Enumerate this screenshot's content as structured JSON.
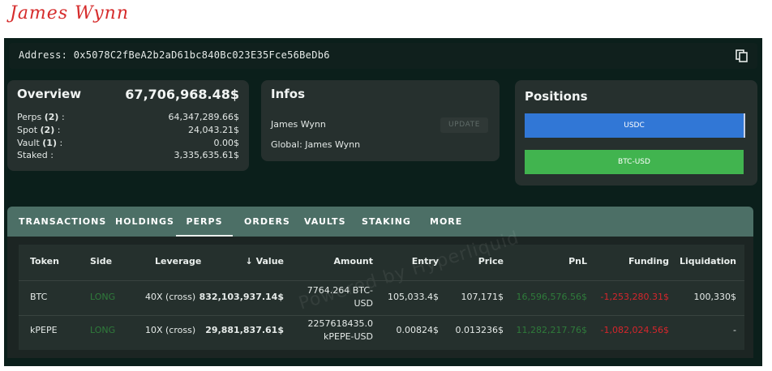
{
  "page_title": "James Wynn",
  "address": {
    "label": "Address:",
    "value": "0x5078C2fBeA2b2aD61bc840Bc023E35Fce56BeDb6"
  },
  "overview": {
    "heading": "Overview",
    "total": "67,706,968.48$",
    "rows": [
      {
        "label": "Perps",
        "count": "(2)",
        "suffix": " :",
        "value": "64,347,289.66$"
      },
      {
        "label": "Spot",
        "count": "(2)",
        "suffix": " :",
        "value": "24,043.21$"
      },
      {
        "label": "Vault",
        "count": "(1)",
        "suffix": " :",
        "value": "0.00$"
      },
      {
        "label": "Staked",
        "count": "",
        "suffix": " :",
        "value": "3,335,635.61$"
      }
    ]
  },
  "infos": {
    "heading": "Infos",
    "name": "James Wynn",
    "global": "Global: James Wynn",
    "update_label": "UPDATE"
  },
  "positions": {
    "heading": "Positions",
    "bars": [
      {
        "label": "USDC",
        "color": "#3177d6"
      },
      {
        "label": "BTC-USD",
        "color": "#41b44f"
      }
    ]
  },
  "tabs": [
    {
      "label": "TRANSACTIONS",
      "active": false
    },
    {
      "label": "HOLDINGS",
      "active": false
    },
    {
      "label": "PERPS",
      "active": true
    },
    {
      "label": "ORDERS",
      "active": false
    },
    {
      "label": "VAULTS",
      "active": false
    },
    {
      "label": "STAKING",
      "active": false
    },
    {
      "label": "MORE",
      "active": false
    }
  ],
  "table": {
    "headers": {
      "token": "Token",
      "side": "Side",
      "leverage": "Leverage",
      "value": "↓ Value",
      "amount": "Amount",
      "entry": "Entry",
      "price": "Price",
      "pnl": "PnL",
      "funding": "Funding",
      "liquidation": "Liquidation"
    },
    "rows": [
      {
        "token": "BTC",
        "side": "LONG",
        "leverage": "40X (cross)",
        "value": "832,103,937.14$",
        "amount_line1": "7764.264 BTC-",
        "amount_line2": "USD",
        "entry": "105,033.4$",
        "price": "107,171$",
        "pnl": "16,596,576.56$",
        "funding": "-1,253,280.31$",
        "liquidation": "100,330$"
      },
      {
        "token": "kPEPE",
        "side": "LONG",
        "leverage": "10X (cross)",
        "value": "29,881,837.61$",
        "amount_line1": "2257618435.0",
        "amount_line2": "kPEPE-USD",
        "entry": "0.00824$",
        "price": "0.013236$",
        "pnl": "11,282,217.76$",
        "funding": "-1,082,024.56$",
        "liquidation": "-"
      }
    ]
  },
  "watermark": "Powered by Hyperliquid",
  "colors": {
    "long": "#2f7b3b",
    "negative": "#d6262c",
    "tabs_bg": "#4c6f66",
    "title": "#d62c2c"
  }
}
